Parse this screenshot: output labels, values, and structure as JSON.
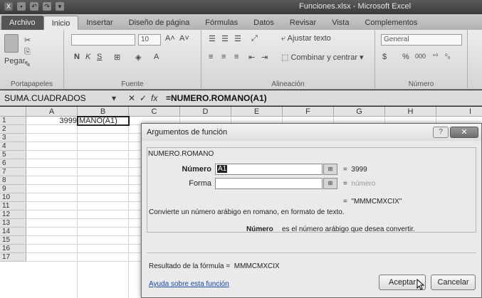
{
  "window": {
    "title": "Funciones.xlsx - Microsoft Excel"
  },
  "ribbon_tabs": [
    "Archivo",
    "Inicio",
    "Insertar",
    "Diseño de página",
    "Fórmulas",
    "Datos",
    "Revisar",
    "Vista",
    "Complementos"
  ],
  "ribbon": {
    "paste_label": "Pegar",
    "font_size": "10",
    "wrap_text": "Ajustar texto",
    "merge_center": "Combinar y centrar",
    "number_format": "General",
    "currency": "$",
    "percent": "%",
    "thousands": "000",
    "groups": {
      "clipboard": "Portapapeles",
      "font": "Fuente",
      "alignment": "Alineación",
      "number": "Número"
    }
  },
  "formula_bar": {
    "name_box": "SUMA.CUADRADOS",
    "cancel": "✕",
    "enter": "✓",
    "fx": "fx",
    "formula": "=NUMERO.ROMANO(A1)"
  },
  "columns": [
    "A",
    "B",
    "C",
    "D",
    "E",
    "F",
    "G",
    "H",
    "I"
  ],
  "rows": [
    "1",
    "2",
    "3",
    "4",
    "5",
    "6",
    "7",
    "8",
    "9",
    "10",
    "11",
    "12",
    "13",
    "14",
    "15",
    "16",
    "17"
  ],
  "cells": {
    "A1": "3999",
    "B1": "MANO(A1)"
  },
  "dialog": {
    "title": "Argumentos de función",
    "help_btn": "?",
    "close_btn": "✕",
    "function_name": "NUMERO.ROMANO",
    "args": [
      {
        "label": "Número",
        "value": "A1",
        "result": "3999",
        "bold": true
      },
      {
        "label": "Forma",
        "value": "",
        "result": "número",
        "bold": false
      }
    ],
    "eq": "=",
    "combined_result": "\"MMMCMXCIX\"",
    "description": "Convierte un número arábigo en romano, en formato de texto.",
    "arg_help_name": "Número",
    "arg_help_text": "es el número arábigo que desea convertir.",
    "result_label": "Resultado de la fórmula =",
    "result_value": "MMMCMXCIX",
    "help_link": "Ayuda sobre esta función",
    "ok": "Aceptar",
    "cancel": "Cancelar"
  }
}
